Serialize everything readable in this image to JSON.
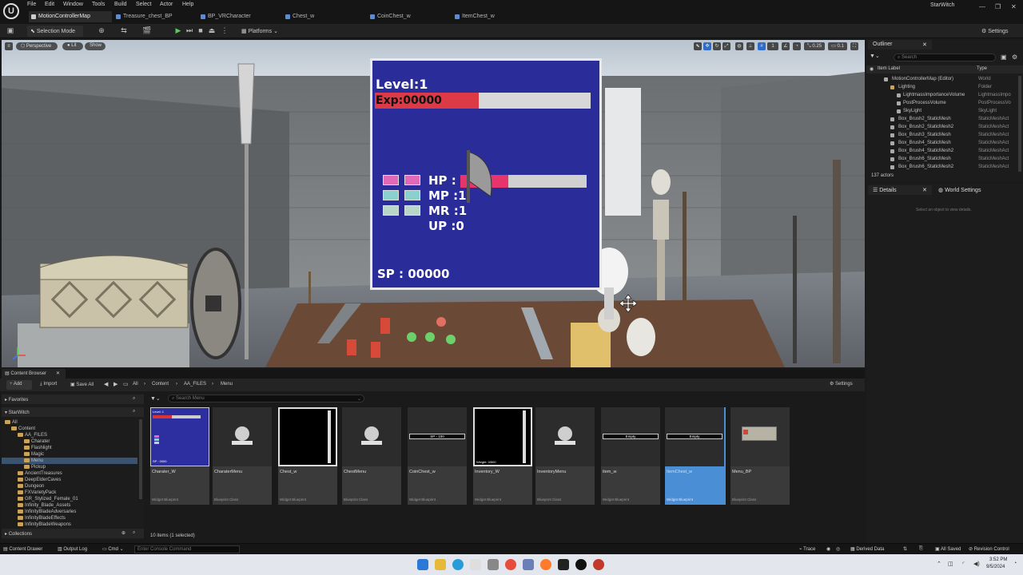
{
  "menubar": {
    "items": [
      "File",
      "Edit",
      "Window",
      "Tools",
      "Build",
      "Select",
      "Actor",
      "Help"
    ],
    "project_name": "StarWitch",
    "tabs": [
      "MotionControllerMap",
      "Treasure_chest_BP",
      "BP_VRCharacter",
      "Chest_w",
      "CoinChest_w",
      "ItemChest_w"
    ]
  },
  "toolbar": {
    "selection_mode": "Selection Mode",
    "platforms": "Platforms",
    "settings": "Settings"
  },
  "viewport": {
    "perspective": "Perspective",
    "lit": "Lit",
    "show": "Show",
    "snap_values": [
      "1",
      "0.25",
      "0.1"
    ],
    "hud": {
      "level": "Level:1",
      "exp": "Exp:00000",
      "hp": "HP :",
      "mp": "MP :1",
      "mr": "MR :1",
      "up": "UP :0",
      "sp": "SP : 00000"
    }
  },
  "outliner": {
    "tab": "Outliner",
    "search_placeholder": "Search",
    "col_label": "Item Label",
    "col_type": "Type",
    "rows": [
      {
        "label": "MotionControllerMap (Editor)",
        "type": "World"
      },
      {
        "label": "Lighting",
        "type": "Folder"
      },
      {
        "label": "LightmassImportanceVolume",
        "type": "LightmassImpo"
      },
      {
        "label": "PostProcessVolume",
        "type": "PostProcessVo"
      },
      {
        "label": "SkyLight",
        "type": "SkyLight"
      },
      {
        "label": "Box_Brush2_StaticMesh",
        "type": "StaticMeshAct"
      },
      {
        "label": "Box_Brush2_StaticMesh2",
        "type": "StaticMeshAct"
      },
      {
        "label": "Box_Brush3_StaticMesh",
        "type": "StaticMeshAct"
      },
      {
        "label": "Box_Brush4_StaticMesh",
        "type": "StaticMeshAct"
      },
      {
        "label": "Box_Brush4_StaticMesh2",
        "type": "StaticMeshAct"
      },
      {
        "label": "Box_Brush6_StaticMesh",
        "type": "StaticMeshAct"
      },
      {
        "label": "Box_Brush6_StaticMesh2",
        "type": "StaticMeshAct"
      }
    ],
    "actor_count": "137 actors"
  },
  "details": {
    "tab_details": "Details",
    "tab_world": "World Settings",
    "empty_msg": "Select an object to view details."
  },
  "content_browser": {
    "tab": "Content Browser",
    "add": "Add",
    "import": "Import",
    "save_all": "Save All",
    "breadcrumb": [
      "All",
      "Content",
      "AA_FILES",
      "Menu"
    ],
    "settings": "Settings",
    "favorites": "Favorites",
    "project": "StarWitch",
    "search_placeholder": "Search Menu",
    "collections": "Collections",
    "item_count": "10 items (1 selected)",
    "tree": [
      {
        "label": "All",
        "depth": 0
      },
      {
        "label": "Content",
        "depth": 1
      },
      {
        "label": "AA_FILES",
        "depth": 2
      },
      {
        "label": "Charater",
        "depth": 3
      },
      {
        "label": "Flashlight",
        "depth": 3
      },
      {
        "label": "Magic",
        "depth": 3
      },
      {
        "label": "Menu",
        "depth": 3
      },
      {
        "label": "Pickup",
        "depth": 3
      },
      {
        "label": "AncientTreasures",
        "depth": 2
      },
      {
        "label": "DeepElderCaves",
        "depth": 2
      },
      {
        "label": "Dungeon",
        "depth": 2
      },
      {
        "label": "FXVarietyPack",
        "depth": 2
      },
      {
        "label": "GR_Stylized_Female_01",
        "depth": 2
      },
      {
        "label": "Infinity_Blade_Assets",
        "depth": 2
      },
      {
        "label": "InfinityBladeAdversaries",
        "depth": 2
      },
      {
        "label": "InfinityBladeEffects",
        "depth": 2
      },
      {
        "label": "InfinityBladeWeapons",
        "depth": 2
      }
    ],
    "assets": [
      {
        "name": "Charater_W",
        "kind": "Widget Blueprint",
        "thumb": "hud"
      },
      {
        "name": "CharaterMenu",
        "kind": "Blueprint Class",
        "thumb": "sphere"
      },
      {
        "name": "Chest_w",
        "kind": "Widget Blueprint",
        "thumb": "black"
      },
      {
        "name": "ChestMenu",
        "kind": "Blueprint Class",
        "thumb": "sphere"
      },
      {
        "name": "CoinChest_w",
        "kind": "Widget Blueprint",
        "thumb": "bar",
        "bar_text": "SP - 100"
      },
      {
        "name": "Inventory_W",
        "kind": "Widget Blueprint",
        "thumb": "black",
        "foot_text": "Weight: 0/500"
      },
      {
        "name": "InventoryMenu",
        "kind": "Blueprint Class",
        "thumb": "sphere"
      },
      {
        "name": "item_w",
        "kind": "Widget Blueprint",
        "thumb": "bar",
        "bar_text": "Empty"
      },
      {
        "name": "ItemChest_w",
        "kind": "Widget Blueprint",
        "thumb": "bar",
        "bar_text": "Empty"
      },
      {
        "name": "Menu_BP",
        "kind": "Blueprint Class",
        "thumb": "scene"
      }
    ]
  },
  "statusbar": {
    "content_drawer": "Content Drawer",
    "output_log": "Output Log",
    "cmd": "Cmd",
    "console_placeholder": "Enter Console Command",
    "trace": "Trace",
    "derived_data": "Derived Data",
    "all_saved": "All Saved",
    "revision_control": "Revision Control"
  },
  "taskbar": {
    "time": "3:52 PM",
    "date": "9/5/2024"
  }
}
